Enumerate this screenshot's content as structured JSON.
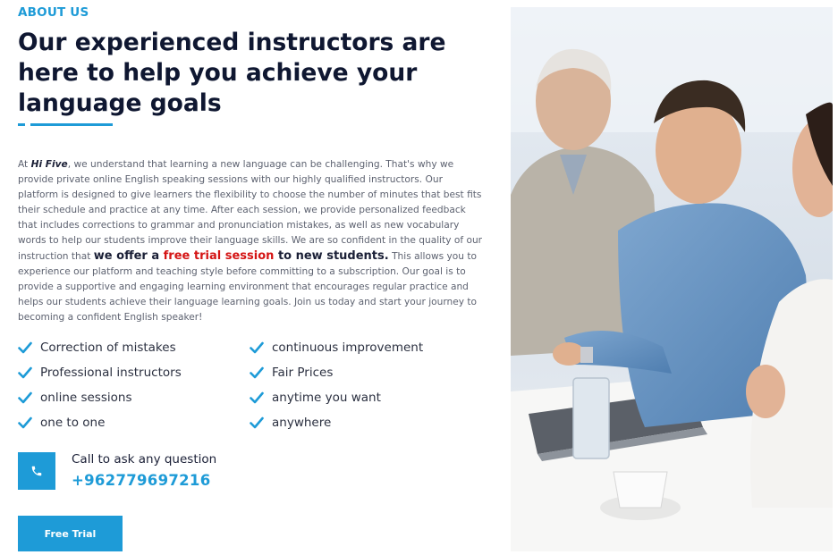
{
  "section_label": "ABOUT US",
  "title": "Our experienced instructors are here to help you achieve your language goals",
  "intro": {
    "prefix": "At",
    "brand": "Hi Five",
    "body1": ", we understand that learning a new language can be challenging. That's why we provide private online English speaking sessions with our highly qualified instructors. Our platform is designed to give learners the flexibility to choose the number of minutes that best fits their schedule and practice at any time. After each session, we provide personalized feedback that includes corrections to grammar and pronunciation mistakes, as well as new vocabulary words to help our students improve their language skills. We are so confident in the quality of our instruction that",
    "highlight_prefix": "we offer a",
    "highlight_red": "free trial session",
    "highlight_suffix": "to new students.",
    "body2": "This allows you to experience our platform and teaching style before committing to a subscription. Our goal is to provide a supportive and engaging learning environment that encourages regular practice and helps our students achieve their language learning goals. Join us today and start your journey to becoming a confident English speaker!"
  },
  "features": [
    {
      "label": "Correction of mistakes",
      "icon": "check-icon"
    },
    {
      "label": "continuous improvement",
      "icon": "check-icon"
    },
    {
      "label": "Professional instructors",
      "icon": "check-icon"
    },
    {
      "label": "Fair Prices",
      "icon": "check-icon"
    },
    {
      "label": "online sessions",
      "icon": "check-icon"
    },
    {
      "label": "anytime you want",
      "icon": "check-icon"
    },
    {
      "label": "one to one",
      "icon": "check-icon"
    },
    {
      "label": "anywhere",
      "icon": "check-icon"
    }
  ],
  "contact": {
    "icon": "phone-icon",
    "label": "Call to ask any question",
    "phone": "+962779697216"
  },
  "cta": {
    "label": "Free Trial"
  },
  "photo": {
    "icon": "team-photo"
  },
  "colors": {
    "accent": "#1e9bd7",
    "heading": "#0f1731",
    "body_text": "#5d6270",
    "highlight_red": "#d41414"
  }
}
